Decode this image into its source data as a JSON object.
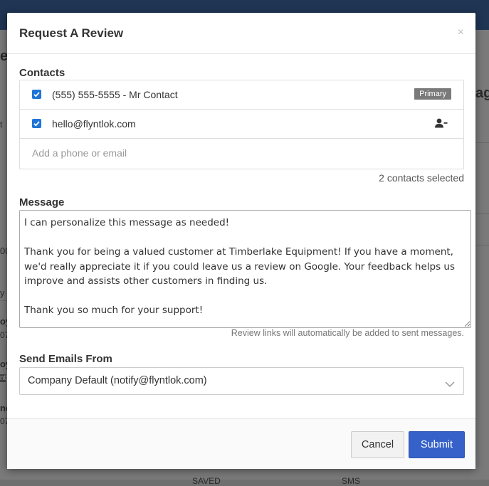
{
  "background": {
    "fragments": [
      "e",
      "ag",
      "t",
      "00",
      "y",
      "oy",
      "07",
      "oy",
      "nt",
      "nc",
      "07",
      "SAVED",
      "SMS"
    ]
  },
  "modal": {
    "title": "Request A Review",
    "close_symbol": "×"
  },
  "contacts": {
    "label": "Contacts",
    "items": [
      {
        "text": "(555) 555-5555 - Mr Contact",
        "checked": true,
        "badge": "Primary"
      },
      {
        "text": "hello@flyntlok.com",
        "checked": true,
        "action_icon": "remove-user-icon"
      }
    ],
    "add_placeholder": "Add a phone or email",
    "selected_count": "2 contacts selected"
  },
  "message": {
    "label": "Message",
    "value": "I can personalize this message as needed!\n\nThank you for being a valued customer at Timberlake Equipment! If you have a moment, we'd really appreciate it if you could leave us a review on Google. Your feedback helps us improve and assists other customers in finding us.\n\nThank you so much for your support!",
    "hint": "Review links will automatically be added to sent messages."
  },
  "send_from": {
    "label": "Send Emails From",
    "selected": "Company Default (notify@flyntlok.com)"
  },
  "footer": {
    "cancel_label": "Cancel",
    "submit_label": "Submit"
  },
  "colors": {
    "primary_button": "#3561c8",
    "checkbox": "#1f74d6",
    "badge": "#7a7a7a",
    "topbar": "#1f3553"
  }
}
